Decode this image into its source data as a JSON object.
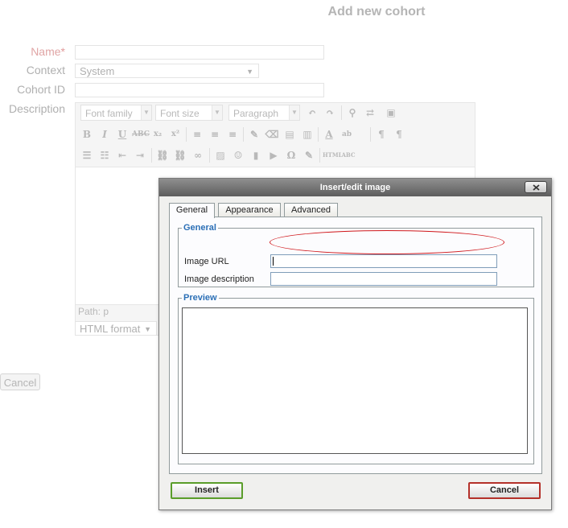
{
  "page": {
    "title": "Add new cohort",
    "form": {
      "name_label": "Name",
      "required_mark": "*",
      "context_label": "Context",
      "context_value": "System",
      "cohort_id_label": "Cohort ID",
      "description_label": "Description",
      "editor": {
        "font_family": "Font family",
        "font_size": "Font size",
        "paragraph": "Paragraph",
        "path_text": "Path: p",
        "format_value": "HTML format"
      },
      "cancel_label": "Cancel"
    }
  },
  "dialog": {
    "title": "Insert/edit image",
    "tabs": [
      {
        "label": "General",
        "active": true
      },
      {
        "label": "Appearance",
        "active": false
      },
      {
        "label": "Advanced",
        "active": false
      }
    ],
    "general_legend": "General",
    "image_url_label": "Image URL",
    "image_url_value": "",
    "image_description_label": "Image description",
    "image_description_value": "",
    "preview_legend": "Preview",
    "insert_label": "Insert",
    "cancel_label": "Cancel"
  },
  "colors": {
    "legend_blue": "#2b6fb6",
    "highlight_red": "#d0181c",
    "insert_border": "#5a9d2a",
    "cancel_border": "#b4312a"
  }
}
